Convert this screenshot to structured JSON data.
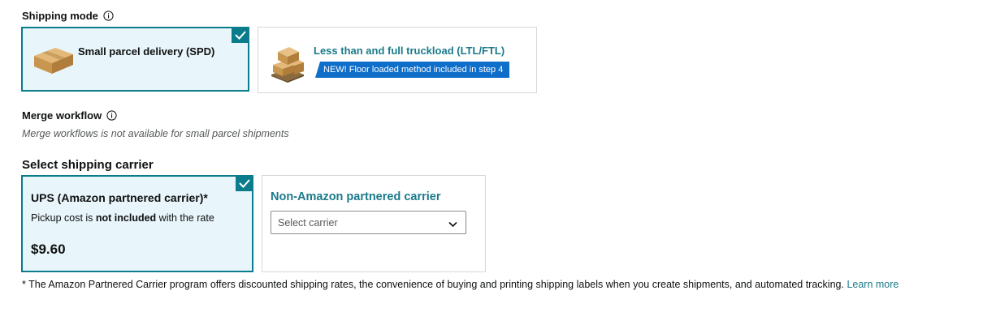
{
  "shipping_mode": {
    "label": "Shipping mode",
    "options": [
      {
        "label": "Small parcel delivery (SPD)",
        "selected": true
      },
      {
        "label": "Less than and full truckload (LTL/FTL)",
        "selected": false,
        "badge": "NEW! Floor loaded method included in step 4"
      }
    ]
  },
  "merge_workflow": {
    "label": "Merge workflow",
    "note": "Merge workflows is not available for small parcel shipments"
  },
  "carrier": {
    "heading": "Select shipping carrier",
    "ups": {
      "title": "UPS (Amazon partnered carrier)*",
      "sub_prefix": "Pickup cost is ",
      "sub_bold": "not included",
      "sub_suffix": " with the rate",
      "price": "$9.60",
      "selected": true
    },
    "non_amazon": {
      "title": "Non-Amazon partnered carrier",
      "select_placeholder": "Select carrier"
    }
  },
  "footnote": {
    "text": "* The Amazon Partnered Carrier program offers discounted shipping rates, the convenience of buying and printing shipping labels when you create shipments, and automated tracking.",
    "link": "Learn more"
  },
  "colors": {
    "accent": "#0a7c8c",
    "selected_bg": "#e8f5fb",
    "badge_bg": "#0f6ec9",
    "link": "#1a7a8a"
  }
}
